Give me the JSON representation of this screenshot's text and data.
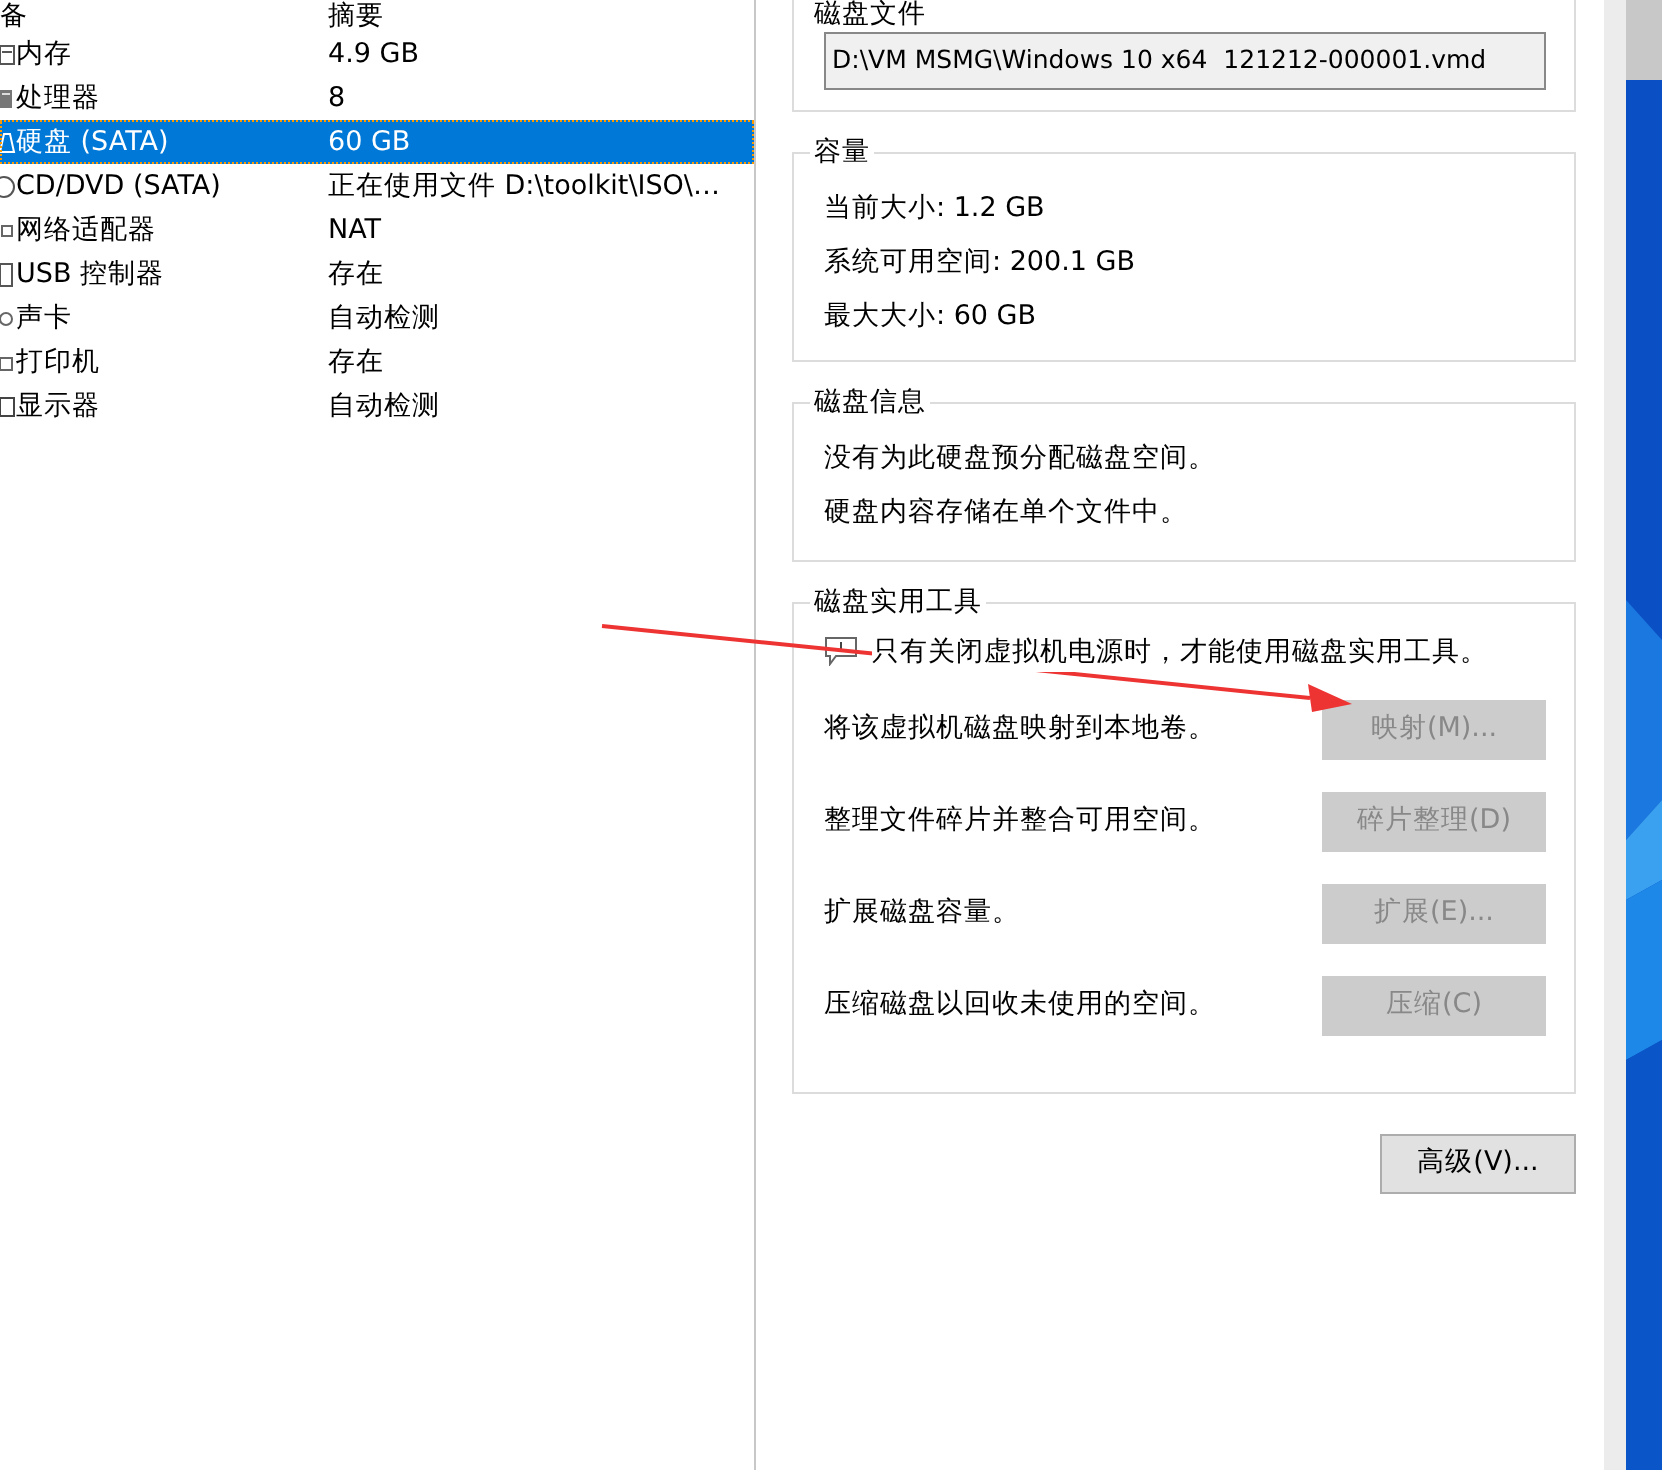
{
  "device_list": {
    "columns": [
      "备",
      "摘要"
    ],
    "rows": [
      {
        "device": "内存",
        "summary": "4.9 GB",
        "kind": "memory",
        "selected": false
      },
      {
        "device": "处理器",
        "summary": "8",
        "kind": "cpu",
        "selected": false
      },
      {
        "device": "硬盘 (SATA)",
        "summary": "60 GB",
        "kind": "disk",
        "selected": true
      },
      {
        "device": "CD/DVD (SATA)",
        "summary": "正在使用文件 D:\\toolkit\\ISO\\…",
        "kind": "cd",
        "selected": false
      },
      {
        "device": "网络适配器",
        "summary": "NAT",
        "kind": "network",
        "selected": false
      },
      {
        "device": "USB 控制器",
        "summary": "存在",
        "kind": "usb",
        "selected": false
      },
      {
        "device": "声卡",
        "summary": "自动检测",
        "kind": "sound",
        "selected": false
      },
      {
        "device": "打印机",
        "summary": "存在",
        "kind": "printer",
        "selected": false
      },
      {
        "device": "显示器",
        "summary": "自动检测",
        "kind": "display",
        "selected": false
      }
    ]
  },
  "disk_file": {
    "title": "磁盘文件",
    "value": "D:\\VM MSMG\\Windows 10 x64  121212-000001.vmd"
  },
  "capacity": {
    "title": "容量",
    "lines": [
      "当前大小: 1.2 GB",
      "系统可用空间: 200.1 GB",
      "最大大小: 60 GB"
    ]
  },
  "disk_info": {
    "title": "磁盘信息",
    "lines": [
      "没有为此硬盘预分配磁盘空间。",
      "硬盘内容存储在单个文件中。"
    ]
  },
  "utilities": {
    "title": "磁盘实用工具",
    "note": "只有关闭虚拟机电源时，才能使用磁盘实用工具。",
    "actions": [
      {
        "text": "将该虚拟机磁盘映射到本地卷。",
        "button": "映射(M)...",
        "disabled": true
      },
      {
        "text": "整理文件碎片并整合可用空间。",
        "button": "碎片整理(D)",
        "disabled": true
      },
      {
        "text": "扩展磁盘容量。",
        "button": "扩展(E)...",
        "disabled": true
      },
      {
        "text": "压缩磁盘以回收未使用的空间。",
        "button": "压缩(C)",
        "disabled": true
      }
    ]
  },
  "advanced_button": {
    "label": "高级(V)...",
    "disabled": false
  }
}
